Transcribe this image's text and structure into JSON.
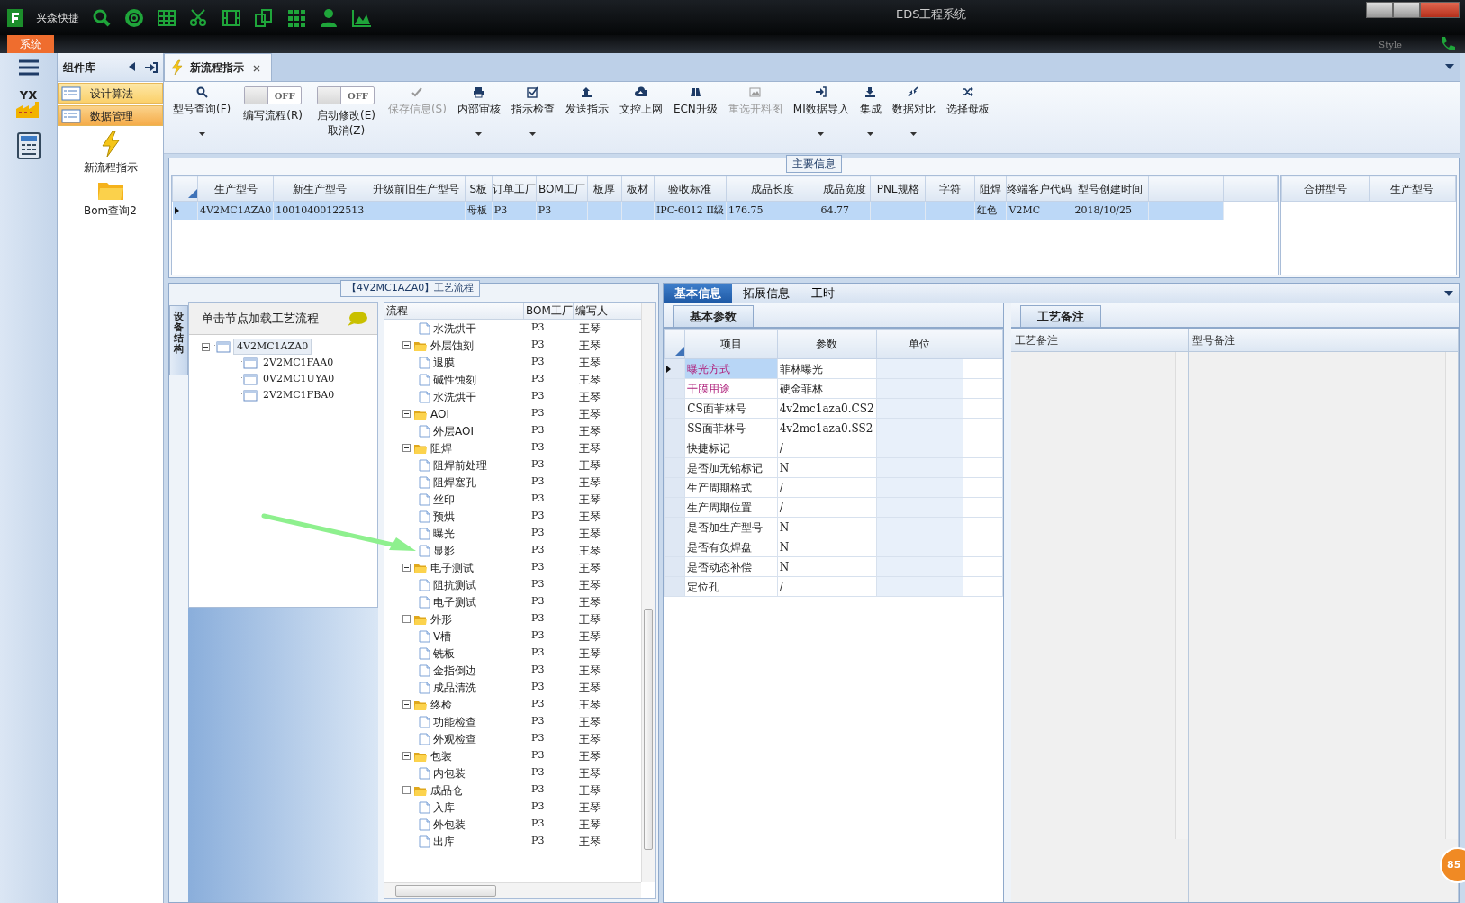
{
  "window": {
    "app_name": "兴森快捷",
    "title": "EDS工程系统"
  },
  "menu": {
    "system_tab": "系统",
    "style_label": "Style"
  },
  "left_strip": {
    "logo_label": "YX"
  },
  "component_panel": {
    "title": "组件库",
    "items": [
      {
        "label": "设计算法",
        "selected": false
      },
      {
        "label": "数据管理",
        "selected": true
      }
    ],
    "launchers": [
      {
        "kind": "lightning",
        "label": "新流程指示"
      },
      {
        "kind": "folder",
        "label": "Bom查询2"
      }
    ]
  },
  "document_tab": {
    "title": "新流程指示"
  },
  "toolbar": [
    {
      "kind": "button",
      "label": "型号查询(F)",
      "dropdown": true,
      "disabled": false
    },
    {
      "kind": "toggle",
      "lines": [
        "编写流程(R)"
      ],
      "toggle_text": "OFF",
      "on": false
    },
    {
      "kind": "toggle",
      "lines": [
        "启动修改(E)",
        "取消(Z)"
      ],
      "toggle_text": "OFF",
      "on": false
    },
    {
      "kind": "button",
      "label": "保存信息(S)",
      "dropdown": false,
      "disabled": true
    },
    {
      "kind": "button",
      "label": "内部审核",
      "dropdown": true,
      "disabled": false
    },
    {
      "kind": "button",
      "label": "指示检查",
      "dropdown": true,
      "disabled": false
    },
    {
      "kind": "button",
      "label": "发送指示",
      "dropdown": false,
      "disabled": false
    },
    {
      "kind": "button",
      "label": "文控上网",
      "dropdown": false,
      "disabled": false
    },
    {
      "kind": "button",
      "label": "ECN升级",
      "dropdown": false,
      "disabled": false
    },
    {
      "kind": "button",
      "label": "重选开料图",
      "dropdown": false,
      "disabled": true
    },
    {
      "kind": "button",
      "label": "MI数据导入",
      "dropdown": true,
      "disabled": false
    },
    {
      "kind": "button",
      "label": "集成",
      "dropdown": true,
      "disabled": false
    },
    {
      "kind": "button",
      "label": "数据对比",
      "dropdown": true,
      "disabled": false
    },
    {
      "kind": "button",
      "label": "选择母板",
      "dropdown": false,
      "disabled": false
    }
  ],
  "main_info": {
    "title": "主要信息",
    "columns": [
      "生产型号",
      "新生产型号",
      "升级前旧生产型号",
      "S板",
      "订单工厂",
      "BOM工厂",
      "板厚",
      "板材",
      "验收标准",
      "成品长度",
      "成品宽度",
      "PNL规格",
      "字符",
      "阻焊",
      "终端客户代码",
      "型号创建时间"
    ],
    "rows": [
      {
        "selected": true,
        "cells": [
          "4V2MC1AZA0",
          "10010400122513",
          null,
          "母板",
          "P3",
          "P3",
          null,
          null,
          "IPC-6012 II级",
          "176.75",
          "64.77",
          null,
          null,
          "红色",
          "V2MC",
          "2018/10/25"
        ]
      }
    ],
    "merge_columns": [
      "合拼型号",
      "生产型号"
    ]
  },
  "flow_panel": {
    "title": "【4V2MC1AZA0】工艺流程",
    "side_tab": "设备结构",
    "hint": "单击节点加载工艺流程",
    "tree": [
      {
        "label": "4V2MC1AZA0",
        "selected": true,
        "expanded": true,
        "children": [
          {
            "label": "2V2MC1FAA0",
            "selected": false
          },
          {
            "label": "0V2MC1UYA0",
            "selected": false
          },
          {
            "label": "2V2MC1FBA0",
            "selected": false
          }
        ]
      }
    ],
    "columns": [
      "流程",
      "BOM工厂",
      "编写人"
    ],
    "rows": [
      {
        "children": [
          {
            "name": "水洗烘干",
            "bom_factory": "P3",
            "author": "王琴"
          }
        ]
      },
      {
        "name": "外层蚀刻",
        "bom_factory": "P3",
        "author": "王琴",
        "expanded": true,
        "children": [
          {
            "name": "退膜",
            "bom_factory": "P3",
            "author": "王琴"
          },
          {
            "name": "碱性蚀刻",
            "bom_factory": "P3",
            "author": "王琴"
          },
          {
            "name": "水洗烘干",
            "bom_factory": "P3",
            "author": "王琴"
          }
        ]
      },
      {
        "name": "AOI",
        "bom_factory": "P3",
        "author": "王琴",
        "expanded": true,
        "children": [
          {
            "name": "外层AOI",
            "bom_factory": "P3",
            "author": "王琴"
          }
        ]
      },
      {
        "name": "阻焊",
        "bom_factory": "P3",
        "author": "王琴",
        "expanded": true,
        "children": [
          {
            "name": "阻焊前处理",
            "bom_factory": "P3",
            "author": "王琴"
          },
          {
            "name": "阻焊塞孔",
            "bom_factory": "P3",
            "author": "王琴"
          },
          {
            "name": "丝印",
            "bom_factory": "P3",
            "author": "王琴"
          },
          {
            "name": "预烘",
            "bom_factory": "P3",
            "author": "王琴"
          },
          {
            "name": "曝光",
            "bom_factory": "P3",
            "author": "王琴"
          },
          {
            "name": "显影",
            "bom_factory": "P3",
            "author": "王琴"
          }
        ]
      },
      {
        "name": "电子测试",
        "bom_factory": "P3",
        "author": "王琴",
        "expanded": true,
        "children": [
          {
            "name": "阻抗测试",
            "bom_factory": "P3",
            "author": "王琴"
          },
          {
            "name": "电子测试",
            "bom_factory": "P3",
            "author": "王琴"
          }
        ]
      },
      {
        "name": "外形",
        "bom_factory": "P3",
        "author": "王琴",
        "expanded": true,
        "children": [
          {
            "name": "V槽",
            "bom_factory": "P3",
            "author": "王琴"
          },
          {
            "name": "铣板",
            "bom_factory": "P3",
            "author": "王琴"
          },
          {
            "name": "金指倒边",
            "bom_factory": "P3",
            "author": "王琴"
          },
          {
            "name": "成品清洗",
            "bom_factory": "P3",
            "author": "王琴"
          }
        ]
      },
      {
        "name": "终检",
        "bom_factory": "P3",
        "author": "王琴",
        "expanded": true,
        "children": [
          {
            "name": "功能检查",
            "bom_factory": "P3",
            "author": "王琴"
          },
          {
            "name": "外观检查",
            "bom_factory": "P3",
            "author": "王琴"
          }
        ]
      },
      {
        "name": "包装",
        "bom_factory": "P3",
        "author": "王琴",
        "expanded": true,
        "children": [
          {
            "name": "内包装",
            "bom_factory": "P3",
            "author": "王琴"
          }
        ]
      },
      {
        "name": "成品仓",
        "bom_factory": "P3",
        "author": "王琴",
        "expanded": true,
        "children": [
          {
            "name": "入库",
            "bom_factory": "P3",
            "author": "王琴"
          },
          {
            "name": "外包装",
            "bom_factory": "P3",
            "author": "王琴"
          },
          {
            "name": "出库",
            "bom_factory": "P3",
            "author": "王琴"
          }
        ]
      }
    ]
  },
  "detail_tabs": [
    {
      "label": "基本信息",
      "selected": true
    },
    {
      "label": "拓展信息",
      "selected": false
    },
    {
      "label": "工时",
      "selected": false
    }
  ],
  "basic_params": {
    "tab": "基本参数",
    "columns": [
      "项目",
      "参数",
      "单位"
    ],
    "rows": [
      {
        "item": "曝光方式",
        "value": "菲林曝光",
        "highlighted": true,
        "selected": true
      },
      {
        "item": "干膜用途",
        "value": "硬金菲林",
        "highlighted": true,
        "selected": false
      },
      {
        "item": "CS面菲林号",
        "value": "4v2mc1aza0.CS2",
        "highlighted": false,
        "selected": false
      },
      {
        "item": "SS面菲林号",
        "value": "4v2mc1aza0.SS2",
        "highlighted": false,
        "selected": false
      },
      {
        "item": "快捷标记",
        "value": "/",
        "highlighted": false,
        "selected": false
      },
      {
        "item": "是否加无铅标记",
        "value": "N",
        "highlighted": false,
        "selected": false
      },
      {
        "item": "生产周期格式",
        "value": "/",
        "highlighted": false,
        "selected": false
      },
      {
        "item": "生产周期位置",
        "value": "/",
        "highlighted": false,
        "selected": false
      },
      {
        "item": "是否加生产型号",
        "value": "N",
        "highlighted": false,
        "selected": false
      },
      {
        "item": "是否有负焊盘",
        "value": "N",
        "highlighted": false,
        "selected": false
      },
      {
        "item": "是否动态补偿",
        "value": "N",
        "highlighted": false,
        "selected": false
      },
      {
        "item": "定位孔",
        "value": "/",
        "highlighted": false,
        "selected": false
      }
    ]
  },
  "notes": {
    "tab": "工艺备注",
    "columns": [
      "工艺备注",
      "型号备注"
    ]
  },
  "badge": "85"
}
